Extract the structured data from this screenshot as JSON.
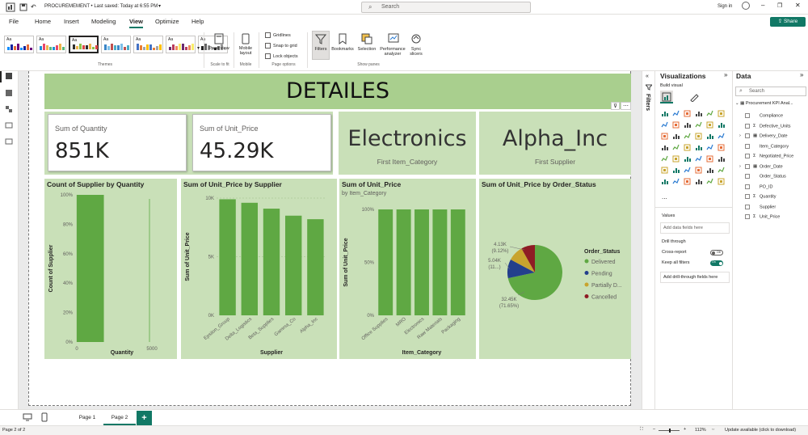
{
  "titlebar": {
    "file_title": "PROCUREMEMENT • Last saved: Today at 6:55 PM",
    "search_placeholder": "Search",
    "signin": "Sign in"
  },
  "menu": {
    "items": [
      "File",
      "Home",
      "Insert",
      "Modeling",
      "View",
      "Optimize",
      "Help"
    ],
    "active": "View",
    "share_label": "Share"
  },
  "ribbon": {
    "themes_group": "Themes",
    "theme_thumb_label": "Aa",
    "page_view": "Page view",
    "scale_to_fit": "Scale to fit",
    "mobile_layout": "Mobile layout",
    "mobile_group": "Mobile",
    "gridlines": "Gridlines",
    "snap_to_grid": "Snap to grid",
    "lock_objects": "Lock objects",
    "page_options": "Page options",
    "filters": "Filters",
    "bookmarks": "Bookmarks",
    "selection": "Selection",
    "performance_analyzer": "Performance analyzer",
    "sync_slicers": "Sync slicers",
    "show_panes": "Show panes"
  },
  "report": {
    "title": "DETAILES",
    "card_quantity": {
      "label": "Sum of Quantity",
      "value": "851K"
    },
    "card_unit_price": {
      "label": "Sum of Unit_Price",
      "value": "45.29K"
    },
    "card_category": {
      "value": "Electronics",
      "label": "First Item_Category"
    },
    "card_supplier": {
      "value": "Alpha_Inc",
      "label": "First Supplier"
    }
  },
  "chart_data": [
    {
      "type": "bar",
      "title": "Count of Supplier by Quantity",
      "xlabel": "Quantity",
      "ylabel": "Count of Supplier",
      "x_ticks": [
        "0",
        "5000"
      ],
      "y_ticks": [
        "0%",
        "20%",
        "40%",
        "60%",
        "80%",
        "100%"
      ],
      "categories": [
        "0"
      ],
      "values": [
        100
      ],
      "ylim": [
        0,
        100
      ]
    },
    {
      "type": "bar",
      "title": "Sum of Unit_Price by Supplier",
      "xlabel": "Supplier",
      "ylabel": "Sum of Unit_Price",
      "y_ticks": [
        "0K",
        "5K",
        "10K"
      ],
      "categories": [
        "Epsilon_Group",
        "Delta_Logistics",
        "Beta_Supplies",
        "Gamma_Co",
        "Alpha_Inc"
      ],
      "values": [
        9900,
        9600,
        9100,
        8500,
        8200
      ],
      "ylim": [
        0,
        10000
      ]
    },
    {
      "type": "bar",
      "title": "Sum of Unit_Price",
      "subtitle": "by Item_Category",
      "xlabel": "Item_Category",
      "ylabel": "Sum of Unit_Price",
      "y_ticks": [
        "0%",
        "50%",
        "100%"
      ],
      "categories": [
        "Office Supplies",
        "MRO",
        "Electronics",
        "Raw Materials",
        "Packaging"
      ],
      "values": [
        100,
        100,
        100,
        100,
        100
      ],
      "ylim": [
        0,
        100
      ]
    },
    {
      "type": "pie",
      "title": "Sum of Unit_Price by Order_Status",
      "legend_title": "Order_Status",
      "slices": [
        {
          "label": "Delivered",
          "value": 32450,
          "percent": "71.65%",
          "display": "32.45K",
          "color": "#5fa843"
        },
        {
          "label": "Pending",
          "value": 5040,
          "percent": "11...",
          "display": "5.04K",
          "color": "#233f8c"
        },
        {
          "label": "Partially D...",
          "value": 4130,
          "percent": "9.12%",
          "display": "4.13K",
          "color": "#c8a42e"
        },
        {
          "label": "Cancelled",
          "value": 3670,
          "percent": "",
          "display": "",
          "color": "#8e1c24"
        }
      ]
    }
  ],
  "visualizations": {
    "title": "Visualizations",
    "build_visual": "Build visual",
    "values_label": "Values",
    "add_data_fields": "Add data fields here",
    "drill_through": "Drill through",
    "cross_report": "Cross-report",
    "cross_report_state": "Off",
    "keep_all_filters": "Keep all filters",
    "keep_all_filters_state": "On",
    "add_drill_fields": "Add drill-through fields here",
    "more": "..."
  },
  "filters_label": "Filters",
  "data_pane": {
    "title": "Data",
    "search_placeholder": "Search",
    "table_name": "Procurement KPI Anal...",
    "fields": [
      {
        "name": "Compliance",
        "sigma": false,
        "expand": false
      },
      {
        "name": "Defective_Units",
        "sigma": true,
        "expand": false
      },
      {
        "name": "Delivery_Date",
        "sigma": false,
        "expand": true,
        "calendar": true
      },
      {
        "name": "Item_Category",
        "sigma": false,
        "expand": false
      },
      {
        "name": "Negotiated_Price",
        "sigma": true,
        "expand": false
      },
      {
        "name": "Order_Date",
        "sigma": false,
        "expand": true,
        "calendar": true
      },
      {
        "name": "Order_Status",
        "sigma": false,
        "expand": false
      },
      {
        "name": "PO_ID",
        "sigma": false,
        "expand": false
      },
      {
        "name": "Quantity",
        "sigma": true,
        "expand": false
      },
      {
        "name": "Supplier",
        "sigma": false,
        "expand": false
      },
      {
        "name": "Unit_Price",
        "sigma": true,
        "expand": false
      }
    ]
  },
  "pages": {
    "tabs": [
      "Page 1",
      "Page 2"
    ],
    "active": "Page 2",
    "add_label": "+"
  },
  "status": {
    "page_info": "Page 2 of 2",
    "zoom": "112%",
    "update": "Update available (click to download)"
  },
  "colors": {
    "accent_green": "#5fa843",
    "tile_bg": "#c9e0b8",
    "header_bg": "#a9cf8e",
    "share_bg": "#117865"
  }
}
